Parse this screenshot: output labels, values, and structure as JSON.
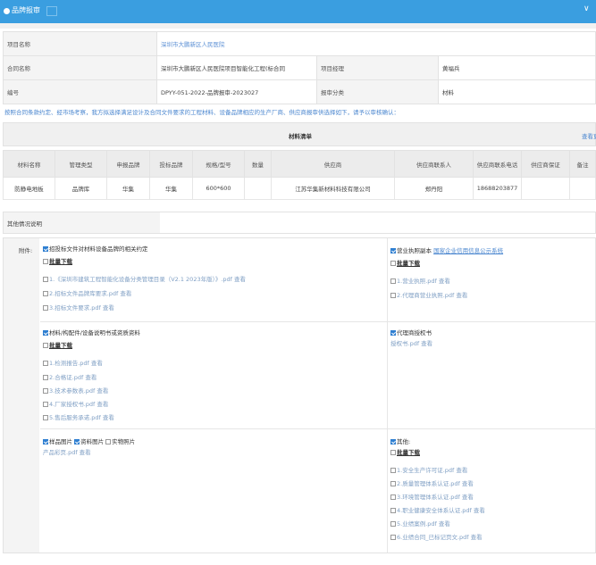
{
  "header": {
    "title": "品牌报审",
    "collapse_glyph": "∨"
  },
  "info": {
    "project_label": "项目名称",
    "project_value": "深圳市大鹏新区人民医院",
    "contract_label": "合同名称",
    "contract_value": "深圳市大鹏新区人民医院项目智能化工程(标合同",
    "manager_label": "项目经理",
    "manager_value": "黄福兵",
    "code_label": "编号",
    "code_value": "DPYY-051-2022-品牌报审-2023027",
    "category_label": "报审分类",
    "category_value": "材料"
  },
  "note": "按照合同条款约定、经市场考察，我方拟选择满足设计及合同文件要求的工程材料、设备品牌相应的生产厂商、供应商报审供选择如下，请予以审核确认：",
  "materials": {
    "title": "材料清单",
    "more": "查看更多",
    "columns": [
      "材料名称",
      "管理类型",
      "申报品牌",
      "投标品牌",
      "规格/型号",
      "数量",
      "供应商",
      "供应商联系人",
      "供应商联系电话",
      "供应商保证",
      "备注"
    ],
    "rows": [
      [
        "防静电地板",
        "品牌库",
        "华集",
        "华集",
        "600*600",
        "",
        "江苏华集新材料科技有限公司",
        "郑丹阳",
        "18688203877",
        "",
        ""
      ]
    ]
  },
  "other_label": "其他情况说明",
  "attach_label": "附件:",
  "sections": {
    "s1": {
      "title": "招投标文件对材料设备品牌的相关约定",
      "batch": "批量下载",
      "files": [
        "1.《深圳市建筑工程智能化设备分类管理目录（V2.1 2023年版）》.pdf 查看",
        "2.招标文件品牌库要求.pdf 查看",
        "3.招标文件要求.pdf 查看"
      ]
    },
    "s2": {
      "title": "营业执照副本",
      "link": "国家企业信用信息公示系统",
      "batch": "批量下载",
      "files": [
        "1.营业执照.pdf 查看",
        "2.代理商营业执照.pdf 查看"
      ]
    },
    "s3": {
      "title": "材料/构配件/设备说明书或资质资料",
      "batch": "批量下载",
      "files": [
        "1.检测报告.pdf 查看",
        "2.合格证.pdf 查看",
        "3.技术参数表.pdf 查看",
        "4.厂家授权书.pdf 查看",
        "5.售后服务承诺.pdf 查看"
      ]
    },
    "s4": {
      "title": "代理商授权书",
      "file": "授权书.pdf 查看"
    },
    "s5": {
      "opt1": "样品图片",
      "opt2": "资料图片",
      "opt3": "实物照片",
      "file": "产品彩页.pdf 查看"
    },
    "s6": {
      "title": "其他:",
      "batch": "批量下载",
      "files": [
        "1.安全生产许可证.pdf 查看",
        "2.质量管理体系认证.pdf 查看",
        "3.环境管理体系认证.pdf 查看",
        "4.职业健康安全体系认证.pdf 查看",
        "5.业绩案例.pdf 查看",
        "6.业绩合同_已标记页文.pdf 查看"
      ]
    }
  },
  "colors": {
    "accent": "#3a9ee0",
    "link": "#4a86cf",
    "checked": "#2f7fd1"
  }
}
